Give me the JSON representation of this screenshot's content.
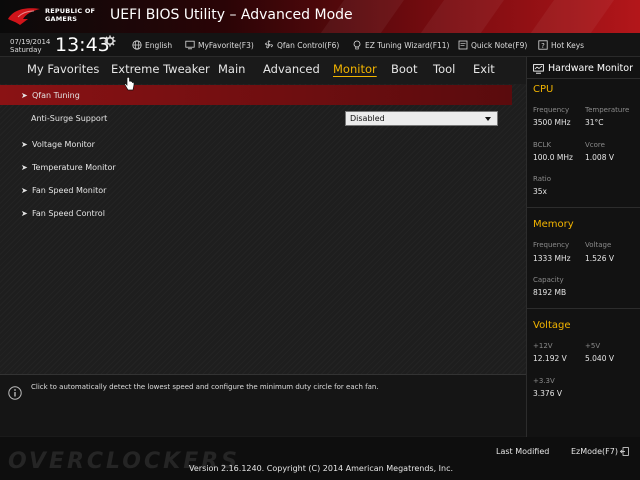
{
  "header": {
    "brand_line1": "REPUBLIC OF",
    "brand_line2": "GAMERS",
    "title": "UEFI BIOS Utility – Advanced Mode",
    "accent": "#b3161a"
  },
  "infobar": {
    "date": "07/19/2014",
    "day": "Saturday",
    "time": "13:43",
    "tools": [
      {
        "label": "English",
        "icon": "globe-icon"
      },
      {
        "label": "MyFavorite(F3)",
        "icon": "favorite-screen-icon"
      },
      {
        "label": "Qfan Control(F6)",
        "icon": "fan-icon"
      },
      {
        "label": "EZ Tuning Wizard(F11)",
        "icon": "bulb-icon"
      },
      {
        "label": "Quick Note(F9)",
        "icon": "note-icon"
      },
      {
        "label": "Hot Keys",
        "icon": "help-icon"
      }
    ]
  },
  "nav": {
    "tabs": [
      "My Favorites",
      "Extreme Tweaker",
      "Main",
      "Advanced",
      "Monitor",
      "Boot",
      "Tool",
      "Exit"
    ],
    "active": "Monitor",
    "active_color": "#f2b400"
  },
  "menu": {
    "items": [
      {
        "label": "Qfan Tuning",
        "submenu": true,
        "selected": true
      },
      {
        "label": "Anti-Surge Support",
        "submenu": false,
        "selected": false,
        "value": "Disabled"
      },
      {
        "label": "Voltage Monitor",
        "submenu": true,
        "selected": false
      },
      {
        "label": "Temperature Monitor",
        "submenu": true,
        "selected": false
      },
      {
        "label": "Fan Speed Monitor",
        "submenu": true,
        "selected": false
      },
      {
        "label": "Fan Speed Control",
        "submenu": true,
        "selected": false
      }
    ]
  },
  "help": {
    "text": "Click to automatically detect the lowest speed and configure the minimum duty circle for each fan."
  },
  "hw": {
    "title": "Hardware Monitor",
    "cpu": {
      "heading": "CPU",
      "frequency_label": "Frequency",
      "frequency": "3500 MHz",
      "temperature_label": "Temperature",
      "temperature": "31°C",
      "bclk_label": "BCLK",
      "bclk": "100.0 MHz",
      "vcore_label": "Vcore",
      "vcore": "1.008 V",
      "ratio_label": "Ratio",
      "ratio": "35x"
    },
    "memory": {
      "heading": "Memory",
      "frequency_label": "Frequency",
      "frequency": "1333 MHz",
      "voltage_label": "Voltage",
      "voltage": "1.526 V",
      "capacity_label": "Capacity",
      "capacity": "8192 MB"
    },
    "voltage": {
      "heading": "Voltage",
      "v12_label": "+12V",
      "v12": "12.192 V",
      "v5_label": "+5V",
      "v5": "5.040 V",
      "v33_label": "+3.3V",
      "v33": "3.376 V"
    }
  },
  "footer": {
    "watermark": "OVERCLOCKERS",
    "last_modified": "Last Modified",
    "ezmode": "EzMode(F7)",
    "version": "Version 2.16.1240. Copyright (C) 2014 American Megatrends, Inc."
  }
}
